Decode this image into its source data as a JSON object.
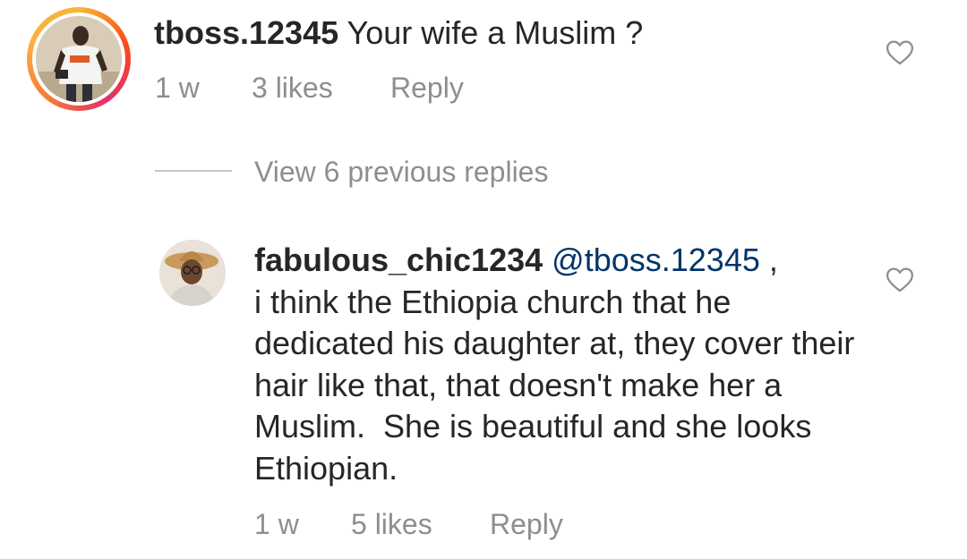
{
  "comments": [
    {
      "username": "tboss.12345",
      "text": "Your wife a Muslim ?",
      "time": "1 w",
      "likes": "3 likes",
      "reply_label": "Reply",
      "avatar_icon": "profile-photo-man"
    },
    {
      "username": "fabulous_chic1234",
      "mention": "@tboss.12345",
      "mention_suffix": " ,",
      "text": "i think the Ethiopia church that he dedicated his daughter at, they cover their hair like that, that doesn't make her a Muslim.  She is beautiful and she looks Ethiopian.",
      "time": "1 w",
      "likes": "5 likes",
      "reply_label": "Reply",
      "avatar_icon": "profile-photo-woman-hat"
    }
  ],
  "view_replies": "View 6 previous replies",
  "icons": {
    "like": "heart-outline-icon"
  },
  "colors": {
    "text": "#262626",
    "muted": "#8e8e8e",
    "mention": "#003569",
    "story_ring": [
      "#f7b733",
      "#fc4a1a",
      "#e1306c"
    ]
  }
}
